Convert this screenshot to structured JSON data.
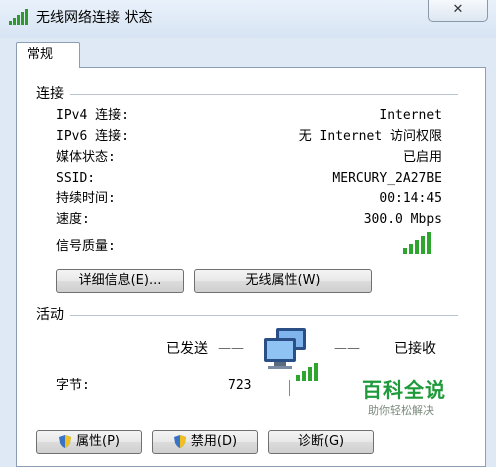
{
  "window": {
    "title": "无线网络连接 状态",
    "close_symbol": "✕"
  },
  "tabs": [
    {
      "label": "常规",
      "active": true
    }
  ],
  "connection": {
    "group_title": "连接",
    "rows": [
      {
        "label": "IPv4 连接:",
        "value": "Internet"
      },
      {
        "label": "IPv6 连接:",
        "value": "无 Internet 访问权限"
      },
      {
        "label": "媒体状态:",
        "value": "已启用"
      },
      {
        "label": "SSID:",
        "value": "MERCURY_2A27BE"
      },
      {
        "label": "持续时间:",
        "value": "00:14:45"
      },
      {
        "label": "速度:",
        "value": "300.0 Mbps"
      }
    ],
    "signal_label": "信号质量:",
    "signal_bars_filled": 5,
    "signal_bars_total": 5,
    "details_button": "详细信息(E)...",
    "wireless_props_button": "无线属性(W)"
  },
  "activity": {
    "group_title": "活动",
    "sent_label": "已发送",
    "received_label": "已接收",
    "dash": "——",
    "bytes_label": "字节:",
    "bytes_sent": "723"
  },
  "buttons": {
    "properties": "属性(P)",
    "disable": "禁用(D)",
    "diagnose": "诊断(G)"
  },
  "watermark": {
    "title": "百科全说",
    "subtitle": "助你轻松解决"
  },
  "colors": {
    "accent_green": "#1f9a3a",
    "window_bg": "#dfe9f5"
  },
  "icons": [
    "wireless-signal-icon",
    "close-icon",
    "network-computers-icon",
    "shield-icon"
  ]
}
